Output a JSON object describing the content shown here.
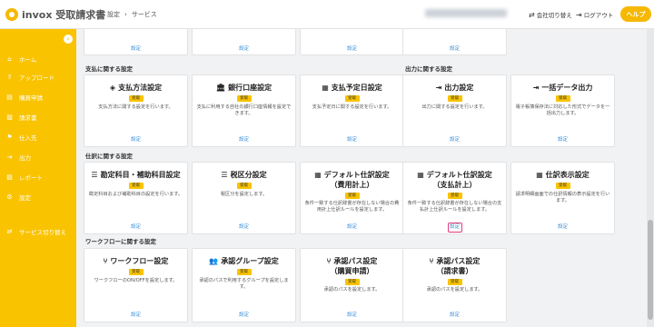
{
  "app": {
    "logo": "invox 受取請求書"
  },
  "breadcrumb": [
    "設定",
    "サービス"
  ],
  "topbar": {
    "switch_company": "会社切り替え",
    "logout": "ログアウト",
    "help": "ヘルプ"
  },
  "sidebar": [
    {
      "icon": "home-icon",
      "glyph": "⌂",
      "label": "ホーム"
    },
    {
      "icon": "upload-icon",
      "glyph": "⇪",
      "label": "アップロード"
    },
    {
      "icon": "purchase-request-icon",
      "glyph": "▤",
      "label": "購買申請"
    },
    {
      "icon": "invoice-icon",
      "glyph": "▥",
      "label": "請求書"
    },
    {
      "icon": "supplier-icon",
      "glyph": "⚑",
      "label": "仕入先"
    },
    {
      "icon": "output-icon",
      "glyph": "⇥",
      "label": "出力"
    },
    {
      "icon": "report-icon",
      "glyph": "▨",
      "label": "レポート"
    },
    {
      "icon": "settings-icon",
      "glyph": "⚙",
      "label": "設定"
    },
    {
      "icon": "service-switch-icon",
      "glyph": "⇄",
      "label": "サービス切り替え"
    }
  ],
  "common": {
    "badge": "受取",
    "link": "設定"
  },
  "sections": [
    {
      "label": "支払に関する設定"
    },
    {
      "label": "出力に関する設定"
    },
    {
      "label": "仕訳に関する設定"
    },
    {
      "label": "ワークフローに関する設定"
    }
  ],
  "cards": {
    "payment_method": {
      "icon": "shield-icon",
      "glyph": "◈",
      "lines": [
        "支払方法設定"
      ],
      "desc": "支払方法に関する設定を行います。"
    },
    "bank_account": {
      "icon": "bank-icon",
      "glyph": "🏛",
      "lines": [
        "銀行口座設定"
      ],
      "desc": "支払に利用する自社の銀行口座情報を設定できます。"
    },
    "payment_schedule": {
      "icon": "calendar-icon",
      "glyph": "▦",
      "lines": [
        "支払予定日設定"
      ],
      "desc": "支払予定日に関する設定を行います。"
    },
    "output": {
      "icon": "output-icon",
      "glyph": "⇥",
      "lines": [
        "出力設定"
      ],
      "desc": "出力に関する設定を行います。"
    },
    "bulk_export": {
      "icon": "export-icon",
      "glyph": "⇥",
      "lines": [
        "一括データ出力"
      ],
      "desc": "電子帳簿保存法に対応した形式でデータを一括出力します。"
    },
    "account_items": {
      "icon": "list-icon",
      "glyph": "☰",
      "lines": [
        "勘定科目・補助科目設定"
      ],
      "desc": "勘定科目および補助科目の設定を行います。"
    },
    "tax_category": {
      "icon": "list-icon",
      "glyph": "☰",
      "lines": [
        "税区分設定"
      ],
      "desc": "税区分を設定します。"
    },
    "journal_default_expense": {
      "icon": "table-icon",
      "glyph": "▦",
      "lines": [
        "デフォルト仕訳設定",
        "（費用計上）"
      ],
      "desc": "条件一致する仕訳辞書が存在しない場合の費用計上仕訳ルールを設定します。"
    },
    "journal_default_payment": {
      "icon": "table-icon",
      "glyph": "▦",
      "lines": [
        "デフォルト仕訳設定",
        "（支払計上）"
      ],
      "desc": "条件一致する仕訳辞書が存在しない場合の支払計上仕訳ルールを設定します。"
    },
    "journal_display": {
      "icon": "table-icon",
      "glyph": "▦",
      "lines": [
        "仕訳表示設定"
      ],
      "desc": "請求明細画面での仕訳情報の表示設定を行います。"
    },
    "workflow": {
      "icon": "workflow-icon",
      "glyph": "⑂",
      "lines": [
        "ワークフロー設定"
      ],
      "desc": "ワークフローのON/OFFを設定します。"
    },
    "approval_group": {
      "icon": "group-icon",
      "glyph": "👥",
      "lines": [
        "承認グループ設定"
      ],
      "desc": "承認のパスで利用するグループを設定します。"
    },
    "approval_path_purchase": {
      "icon": "path-icon",
      "glyph": "⑂",
      "lines": [
        "承認パス設定",
        "（購買申請）"
      ],
      "desc": "承認のパスを設定します。"
    },
    "approval_path_invoice": {
      "icon": "path-icon",
      "glyph": "⑂",
      "lines": [
        "承認パス設定",
        "（請求書）"
      ],
      "desc": "承認のパスを設定します。"
    }
  }
}
